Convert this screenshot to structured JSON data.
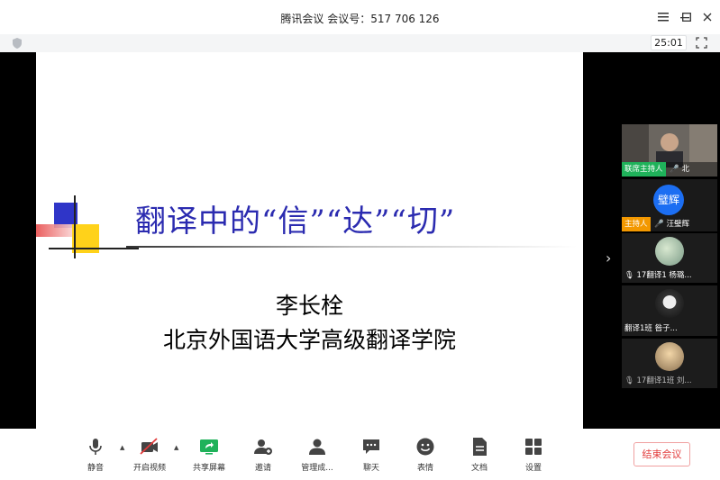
{
  "window": {
    "title": "腾讯会议 会议号：517 706 126"
  },
  "infostrip": {
    "timer": "25:01"
  },
  "slide": {
    "title": "翻译中的“信”“达”“切”",
    "author": "李长栓",
    "institution": "北京外国语大学高级翻译学院"
  },
  "participants": [
    {
      "tag": "联席主持人",
      "name": "北",
      "tag_color": "#1fb25a"
    },
    {
      "avatar_text": "璧辉",
      "tag": "主持人",
      "name": "汪璧辉",
      "tag_color": "#f39800",
      "avatar_color": "#1c6ef2"
    },
    {
      "name": "17翻译1 杨璐..."
    },
    {
      "name": "翻译1班 昝子..."
    },
    {
      "name": "17翻译1班 刘..."
    }
  ],
  "toolbar": {
    "mute": "静音",
    "video": "开启视频",
    "share": "共享屏幕",
    "invite": "邀请",
    "manage": "管理成...",
    "chat": "聊天",
    "emoji": "表情",
    "docs": "文档",
    "settings": "设置",
    "end": "结束会议"
  },
  "colors": {
    "accent_green": "#1fb25a",
    "host_orange": "#f39800",
    "end_red": "#e23b3b",
    "slide_title": "#2b2bb0"
  }
}
